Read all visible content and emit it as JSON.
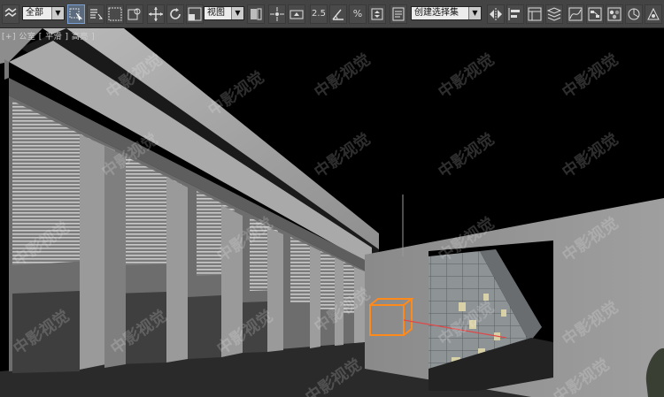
{
  "toolbar": {
    "selection_filter": "全部",
    "reference_coordinate": "视图",
    "named_selection_set": "创建选择集",
    "snap_toggle_label": "2.5",
    "percent_snap_label": "%"
  },
  "viewport": {
    "label": "[+] 公室 [ 平滑 ] 高亮 ]"
  },
  "watermark": {
    "text": "中影视觉"
  },
  "colors": {
    "toolbar_bg": "#444444",
    "viewport_bg": "#000000",
    "selection_gizmo": "#ff8a1c"
  }
}
